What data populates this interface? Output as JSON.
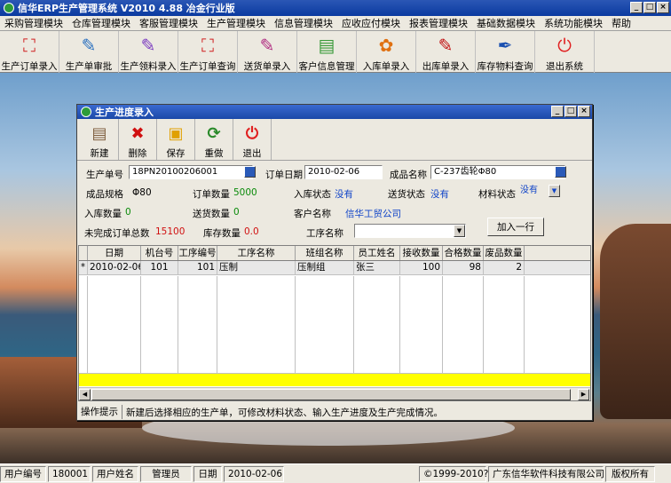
{
  "app": {
    "title": "信华ERP生产管理系统  V2010 4.88 冶金行业版"
  },
  "window_controls": {
    "minimize": "_",
    "maximize": "□",
    "close": "×"
  },
  "menu": [
    "采购管理模块",
    "仓库管理模块",
    "客服管理模块",
    "生产管理模块",
    "信息管理模块",
    "应收应付模块",
    "报表管理模块",
    "基础数据模块",
    "系统功能模块",
    "帮助"
  ],
  "toolbar": [
    {
      "label": "生产订单录入",
      "icon": "pdf-doc-icon",
      "glyph": "⛶",
      "color": "#d02020"
    },
    {
      "label": "生产单审批",
      "icon": "pen-doc-icon",
      "glyph": "✎",
      "color": "#2a70c0"
    },
    {
      "label": "生产领料录入",
      "icon": "pen-doc-icon",
      "glyph": "✎",
      "color": "#7a3ac0"
    },
    {
      "label": "生产订单查询",
      "icon": "pdf-doc-icon",
      "glyph": "⛶",
      "color": "#d02020"
    },
    {
      "label": "送货单录入",
      "icon": "pen-doc-icon",
      "glyph": "✎",
      "color": "#b02a80"
    },
    {
      "label": "客户信息管理",
      "icon": "doc-icon",
      "glyph": "▤",
      "color": "#3a9a3a"
    },
    {
      "label": "入库单录入",
      "icon": "flower-icon",
      "glyph": "✿",
      "color": "#e07010"
    },
    {
      "label": "出库单录入",
      "icon": "pen-doc-icon",
      "glyph": "✎",
      "color": "#c01010"
    },
    {
      "label": "库存物料查询",
      "icon": "feather-icon",
      "glyph": "✒",
      "color": "#1a50b0"
    },
    {
      "label": "退出系统",
      "icon": "power-icon",
      "glyph": "⏻",
      "color": "#e02020"
    }
  ],
  "dialog": {
    "title": "生产进度录入",
    "toolbar": [
      {
        "label": "新建",
        "icon": "new-doc-icon",
        "glyph": "▤",
        "color": "#806040"
      },
      {
        "label": "删除",
        "icon": "delete-x-icon",
        "glyph": "✖",
        "color": "#d01010"
      },
      {
        "label": "保存",
        "icon": "save-disk-icon",
        "glyph": "▣",
        "color": "#e0a000"
      },
      {
        "label": "重做",
        "icon": "redo-arrows-icon",
        "glyph": "⟳",
        "color": "#2a8a2a"
      },
      {
        "label": "退出",
        "icon": "power-icon",
        "glyph": "⏻",
        "color": "#e02020"
      }
    ],
    "form": {
      "order_no_label": "生产单号",
      "order_no": "18PN20100206001",
      "order_date_label": "订单日期",
      "order_date": "2010-02-06",
      "product_name_label": "成品名称",
      "product_name": "C-237齿轮Φ80",
      "spec_label": "成品规格",
      "spec": "Φ80",
      "order_qty_label": "订单数量",
      "order_qty": "5000",
      "stockin_status_label": "入库状态",
      "stockin_status": "没有",
      "delivery_status_label": "送货状态",
      "delivery_status": "没有",
      "material_status_label": "材料状态",
      "material_status": "没有",
      "stockin_qty_label": "入库数量",
      "stockin_qty": "0",
      "delivery_qty_label": "送货数量",
      "delivery_qty": "0",
      "customer_label": "客户名称",
      "customer": "信华工贸公司",
      "unfinished_label": "未完成订单总数",
      "unfinished": "15100",
      "stock_qty_label": "库存数量",
      "stock_qty": "0.0",
      "process_label": "工序名称",
      "process": "",
      "add_row": "加入一行"
    },
    "grid": {
      "headers": [
        "日期",
        "机台号",
        "工序编号",
        "工序名称",
        "班组名称",
        "员工姓名",
        "接收数量",
        "合格数量",
        "废品数量"
      ],
      "rows": [
        {
          "marker": "*",
          "cells": [
            "2010-02-06",
            "101",
            "101",
            "压制",
            "压制组",
            "张三",
            "100",
            "98",
            "2"
          ]
        }
      ]
    },
    "hint": {
      "label": "操作提示",
      "text": "新建后选择相应的生产单，可修改材料状态、输入生产进度及生产完成情况。"
    }
  },
  "status": {
    "user_no_label": "用户编号",
    "user_no": "180001",
    "user_name_label": "用户姓名",
    "user_name": "管理员",
    "date_label": "日期",
    "date": "2010-02-06",
    "copyright": "©1999-2010?",
    "company": "广东信华软件科技有限公司",
    "rights": "版权所有"
  }
}
